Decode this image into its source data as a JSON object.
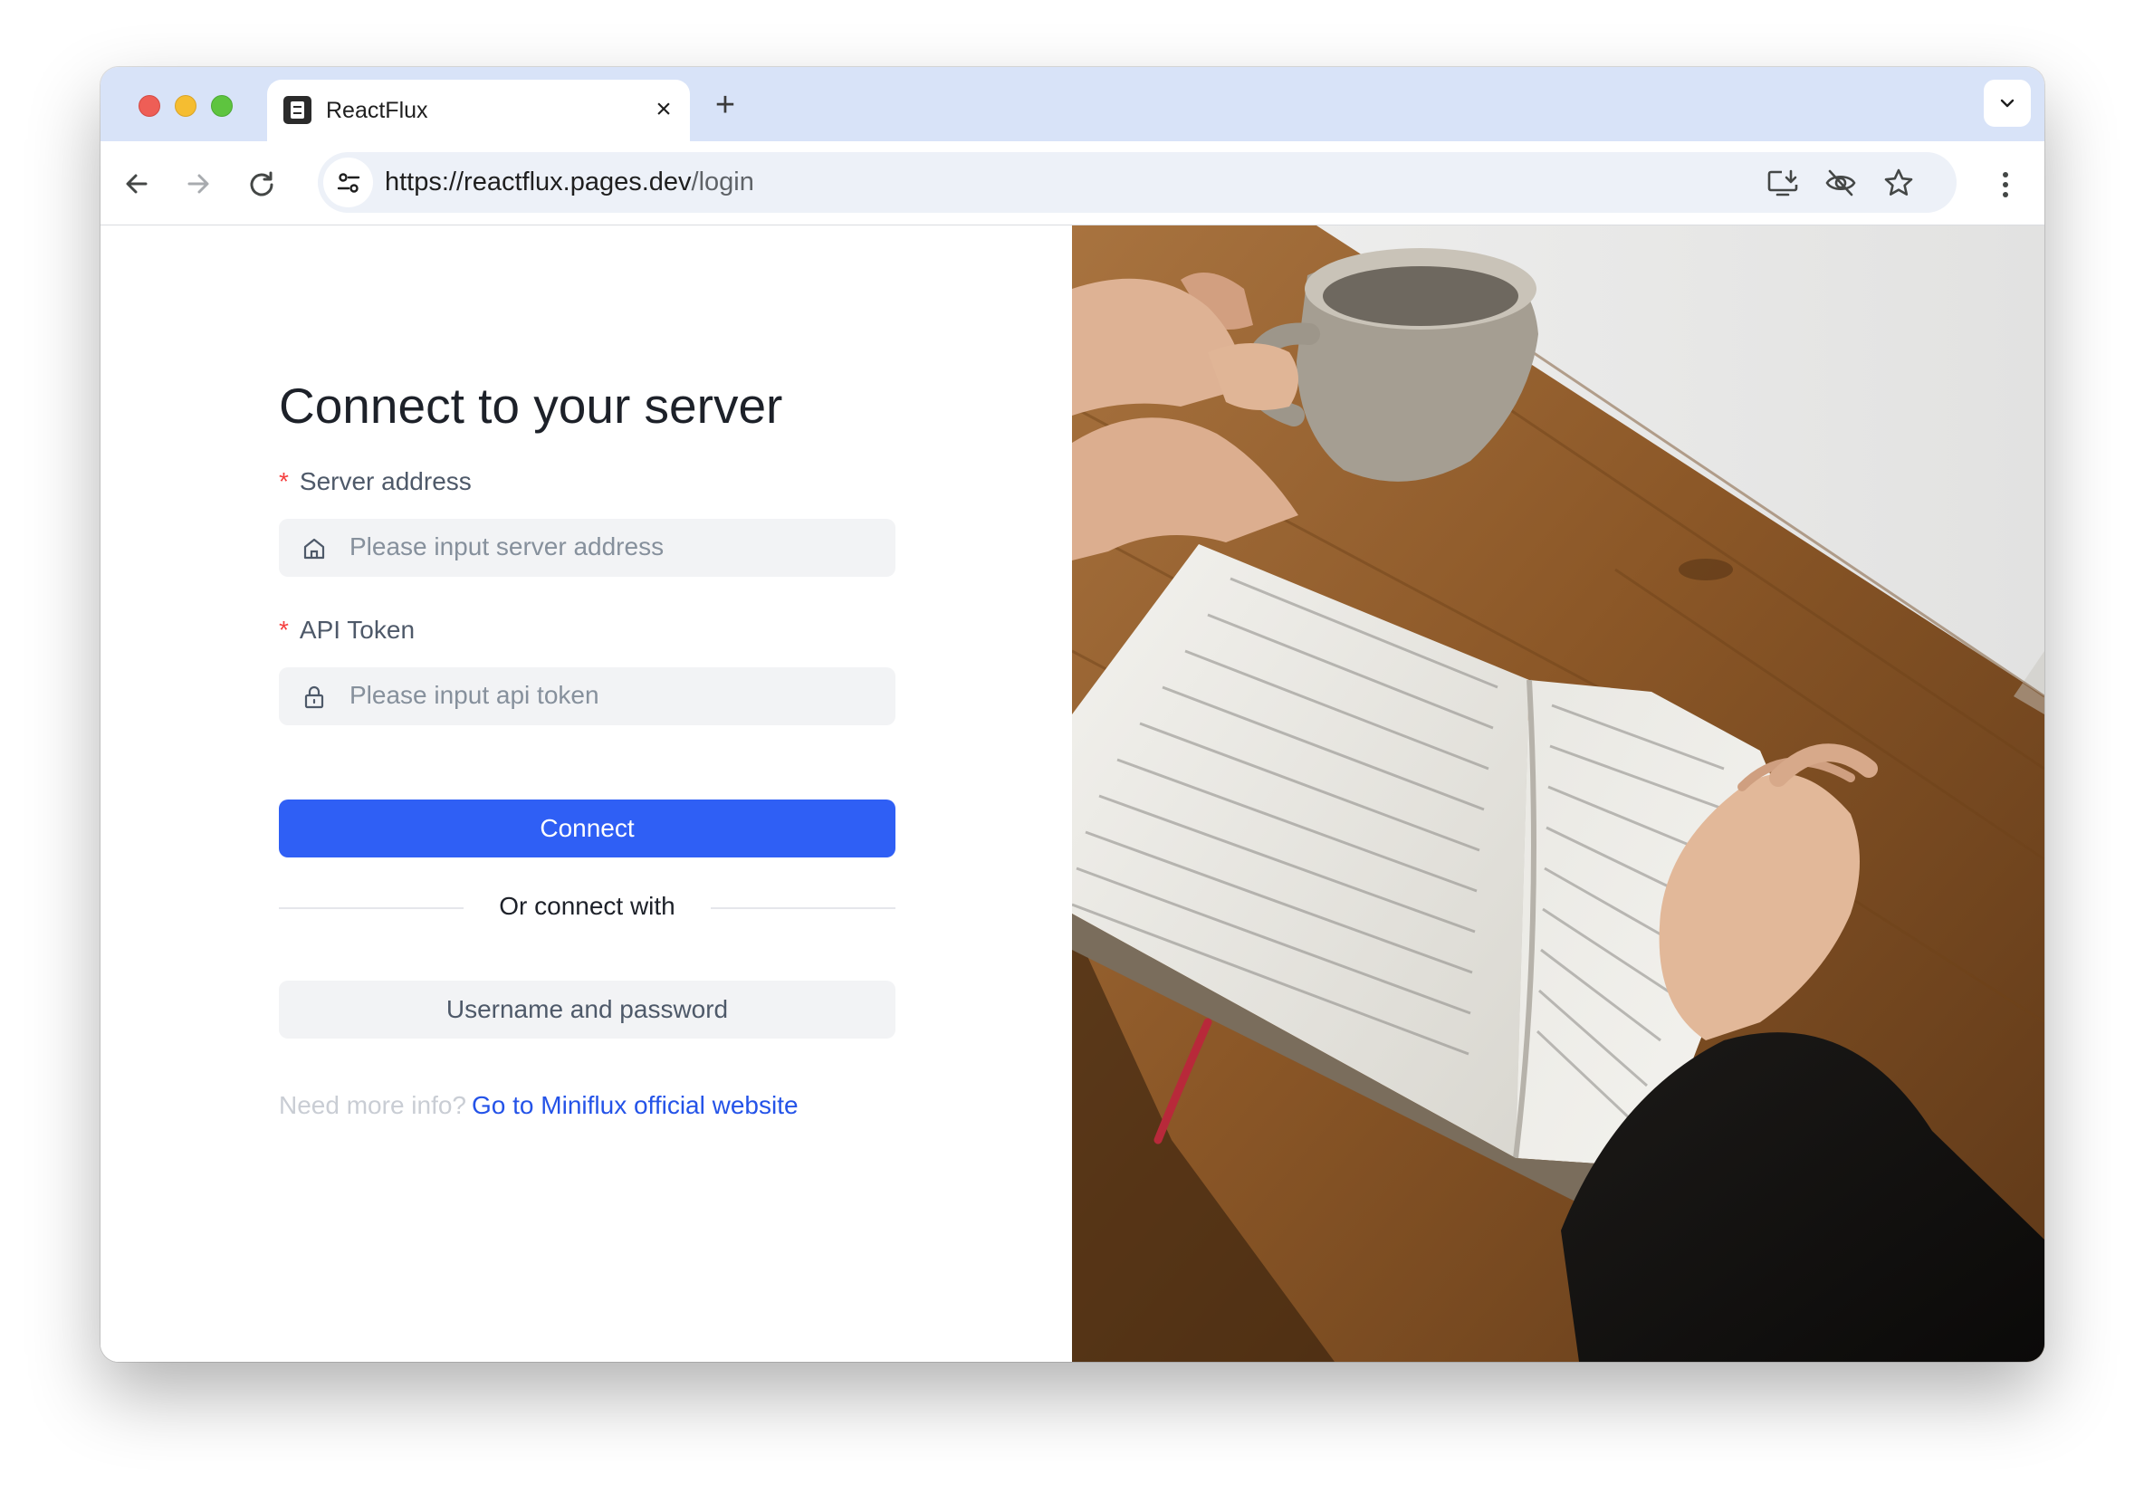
{
  "browser": {
    "tab": {
      "title": "ReactFlux"
    },
    "address_bar": {
      "url_host": "https://reactflux.pages.dev",
      "url_path": "/login"
    }
  },
  "login": {
    "heading": "Connect to your server",
    "server_address": {
      "required_mark": "*",
      "label": "Server address",
      "placeholder": "Please input server address"
    },
    "api_token": {
      "required_mark": "*",
      "label": "API Token",
      "placeholder": "Please input api token"
    },
    "connect_button": "Connect",
    "divider_text": "Or connect with",
    "alt_login_button": "Username and password",
    "footer": {
      "prompt": "Need more info?",
      "link_text": "Go to Miniflux official website"
    }
  },
  "colors": {
    "primary": "#2f5ff5",
    "link": "#2453e8",
    "required": "#f53f3f",
    "tabbar": "#d8e3f8"
  },
  "icons": {
    "server_field": "home-icon",
    "token_field": "lock-icon"
  }
}
